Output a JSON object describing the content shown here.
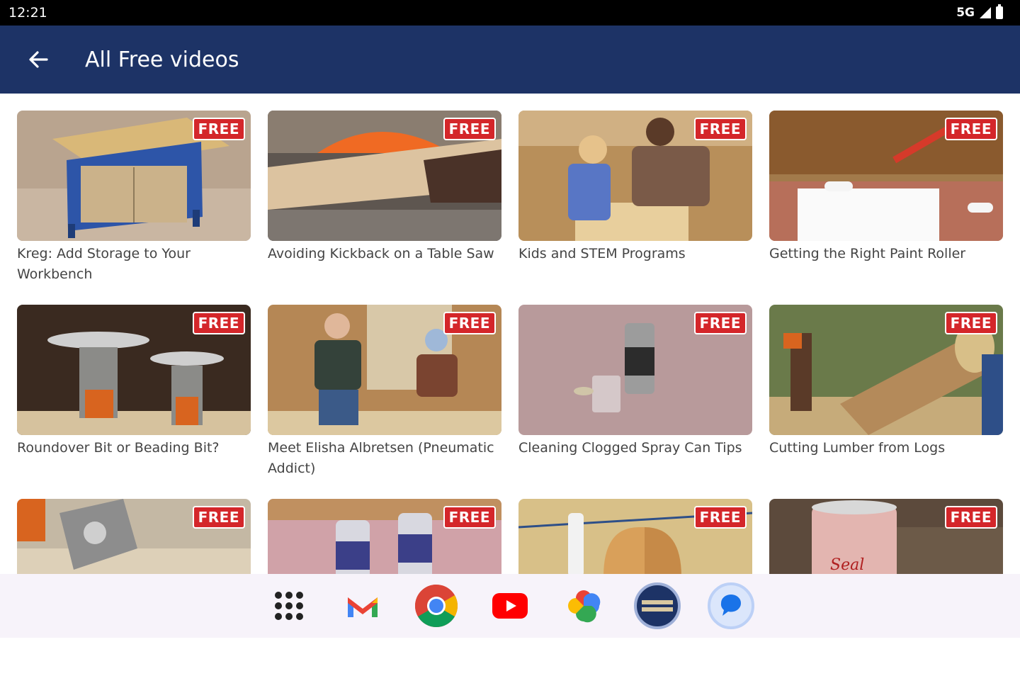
{
  "status": {
    "time": "12:21",
    "network": "5G"
  },
  "appbar": {
    "title": "All Free videos"
  },
  "badge_text": "FREE",
  "videos": [
    {
      "title": "Kreg: Add Storage to Your Workbench"
    },
    {
      "title": "Avoiding Kickback on a Table Saw"
    },
    {
      "title": "Kids and STEM Programs"
    },
    {
      "title": "Getting the Right Paint Roller"
    },
    {
      "title": "Roundover Bit or Beading Bit?"
    },
    {
      "title": "Meet Elisha Albretsen (Pneumatic Addict)"
    },
    {
      "title": "Cleaning Clogged Spray Can Tips"
    },
    {
      "title": "Cutting Lumber from Logs"
    },
    {
      "title": ""
    },
    {
      "title": ""
    },
    {
      "title": ""
    },
    {
      "title": ""
    }
  ],
  "dock": {
    "apps": [
      "app-drawer-icon",
      "gmail-icon",
      "chrome-icon",
      "youtube-icon",
      "photos-icon",
      "woodworking-app-icon",
      "messages-icon"
    ]
  },
  "colors": {
    "appbar": "#1d3366",
    "badge": "#d4262a",
    "dock": "#f7f3fa"
  }
}
